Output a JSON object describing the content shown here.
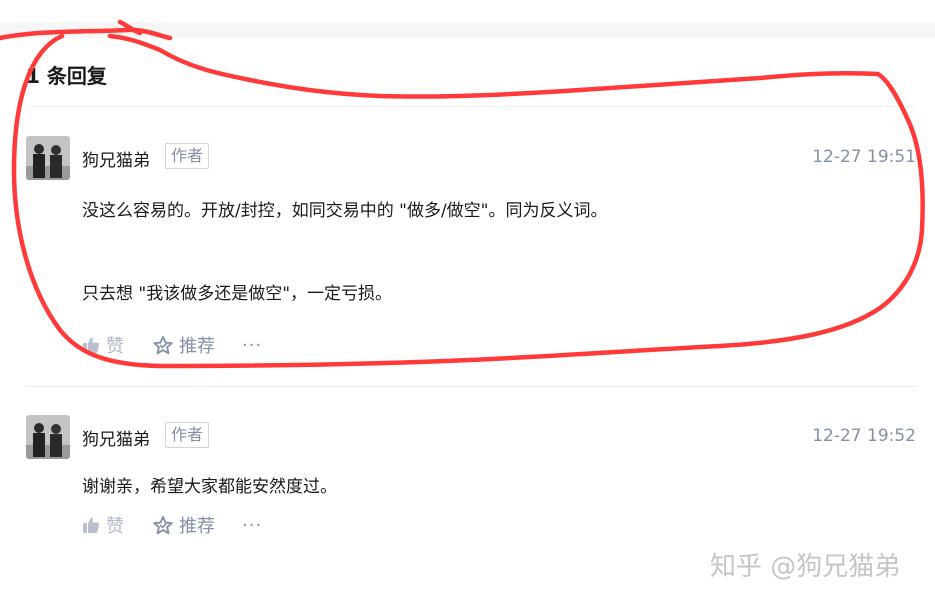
{
  "section": {
    "title": "1 条回复"
  },
  "comments": [
    {
      "author": "狗兄猫弟",
      "tag": "作者",
      "time": "12-27 19:51",
      "paragraphs": [
        "没这么容易的。开放/封控，如同交易中的 \"做多/做空\"。同为反义词。",
        "只去想 \"我该做多还是做空\"，一定亏损。"
      ],
      "actions": {
        "like": "赞",
        "recommend": "推荐",
        "more": "···"
      }
    },
    {
      "author": "狗兄猫弟",
      "tag": "作者",
      "time": "12-27 19:52",
      "paragraphs": [
        "谢谢亲，希望大家都能安然度过。"
      ],
      "actions": {
        "like": "赞",
        "recommend": "推荐",
        "more": "···"
      }
    }
  ],
  "watermark": "知乎 @狗兄猫弟",
  "colors": {
    "annotation": "#ff3a3a",
    "meta": "#8590a6",
    "text": "#1a1a1a"
  },
  "icons": {
    "like": "thumbs-up-icon",
    "recommend": "star-icon",
    "more": "more-dots-icon"
  }
}
